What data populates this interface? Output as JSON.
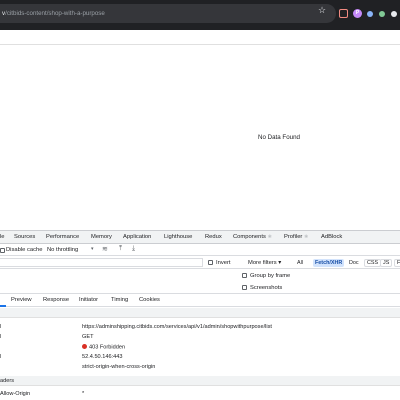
{
  "browser": {
    "url_path": "/citbids-content/shop-with-a-purpose",
    "avatar_letter": "P"
  },
  "page": {
    "empty_message": "No Data Found"
  },
  "devtools": {
    "tabs": [
      "le",
      "Sources",
      "Performance",
      "Memory",
      "Application",
      "Lighthouse",
      "Redux",
      "Components",
      "Profiler",
      "AdBlock"
    ],
    "components_badge": "⚛",
    "profiler_badge": "⚛",
    "toolbar": {
      "disable_cache": "Disable cache",
      "throttling": "No throttling"
    },
    "filter": {
      "invert": "Invert",
      "more_filters": "More filters ▾",
      "chips": [
        "All",
        "Fetch/XHR",
        "Doc",
        "CSS",
        "JS",
        "F"
      ]
    },
    "options": {
      "group_by_frame": "Group by frame",
      "screenshots": "Screenshots"
    },
    "subtabs": [
      "Preview",
      "Response",
      "Initiator",
      "Timing",
      "Cookies"
    ],
    "general": {
      "request_url": "https://adminshipping.citbids.com/services/api/v1/admin/shopwithpurpose/list",
      "method": "GET",
      "status": "403 Forbidden",
      "remote_address": "52.4.50.146:443",
      "referrer_policy": "strict-origin-when-cross-origin"
    },
    "response_headers": {
      "title": "aders",
      "row_key": "Allow-Origin",
      "row_val": "*"
    }
  }
}
